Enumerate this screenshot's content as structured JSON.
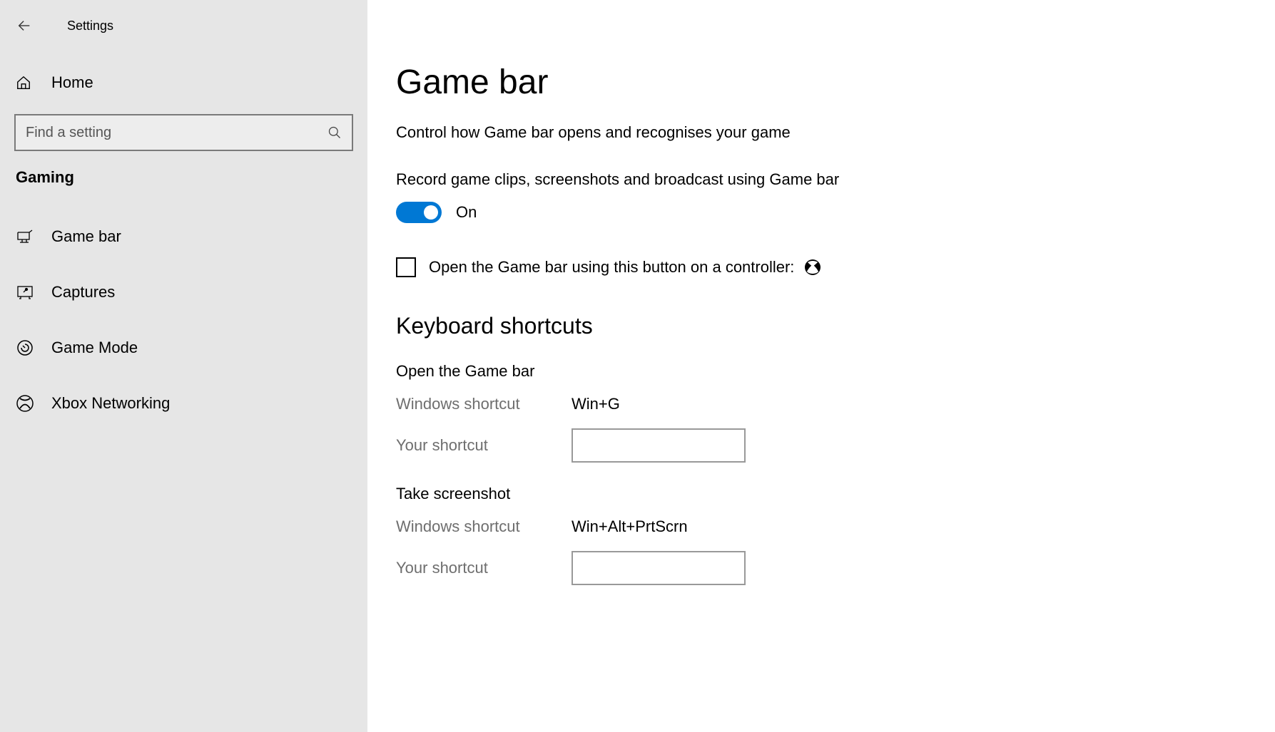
{
  "header": {
    "title": "Settings"
  },
  "sidebar": {
    "home_label": "Home",
    "search_placeholder": "Find a setting",
    "category": "Gaming",
    "items": [
      {
        "label": "Game bar",
        "icon": "gamebar"
      },
      {
        "label": "Captures",
        "icon": "captures"
      },
      {
        "label": "Game Mode",
        "icon": "gamemode"
      },
      {
        "label": "Xbox Networking",
        "icon": "xbox"
      }
    ]
  },
  "main": {
    "title": "Game bar",
    "subtitle": "Control how Game bar opens and recognises your game",
    "record_label": "Record game clips, screenshots and broadcast using Game bar",
    "toggle_state": "On",
    "controller_checkbox_label": "Open the Game bar using this button on a controller:",
    "shortcuts_heading": "Keyboard shortcuts",
    "shortcuts": [
      {
        "title": "Open the Game bar",
        "windows_label": "Windows shortcut",
        "windows_value": "Win+G",
        "your_label": "Your shortcut",
        "your_value": ""
      },
      {
        "title": "Take screenshot",
        "windows_label": "Windows shortcut",
        "windows_value": "Win+Alt+PrtScrn",
        "your_label": "Your shortcut",
        "your_value": ""
      }
    ]
  }
}
